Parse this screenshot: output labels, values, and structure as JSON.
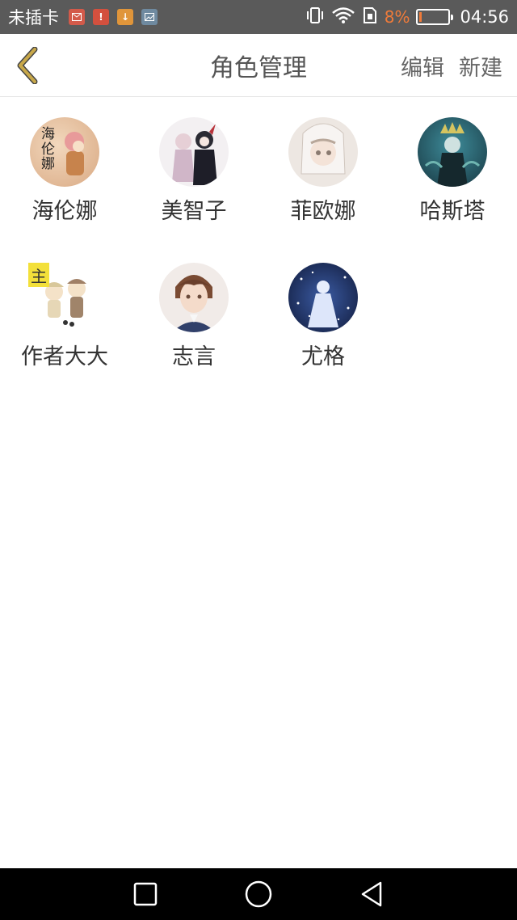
{
  "status_bar": {
    "carrier": "未插卡",
    "battery_percent": "8%",
    "time": "04:56",
    "notification_icons": [
      "mail-icon",
      "alert-icon",
      "download-icon",
      "image-icon"
    ],
    "battery_level": 0.08
  },
  "header": {
    "title": "角色管理",
    "edit_label": "编辑",
    "new_label": "新建",
    "back_icon": "chevron-left-icon"
  },
  "colors": {
    "accent_back": "#c8a84a",
    "status_bg": "#5a5a5a",
    "battery_low": "#f07b3a",
    "badge_yellow": "#f3e03a"
  },
  "roles": [
    {
      "name": "海伦娜",
      "avatar_text": "海\n伦\n娜",
      "avatar_bg": "#e8c9a8"
    },
    {
      "name": "美智子",
      "avatar_bg": "#f3f0f2"
    },
    {
      "name": "菲欧娜",
      "avatar_bg": "#ede7e2"
    },
    {
      "name": "哈斯塔",
      "avatar_bg": "#1e4d5c"
    },
    {
      "name": "作者大大",
      "avatar_bg": "#f7f2ea",
      "badge": "主"
    },
    {
      "name": "志言",
      "avatar_bg": "#f1ebe8"
    },
    {
      "name": "尤格",
      "avatar_bg": "#1b2a5a"
    }
  ]
}
